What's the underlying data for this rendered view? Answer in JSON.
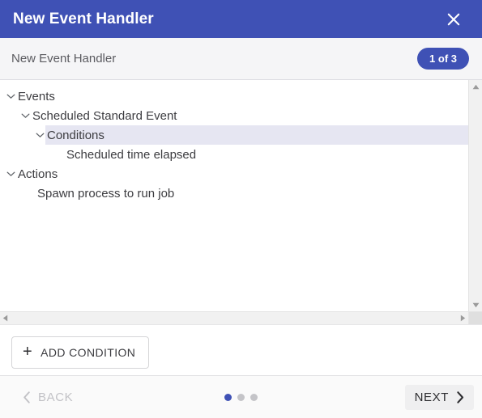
{
  "titlebar": {
    "title": "New Event Handler",
    "close_icon": "close-icon"
  },
  "subheader": {
    "title": "New Event Handler",
    "step_badge": "1 of 3"
  },
  "tree": {
    "rows": [
      {
        "label": "Events",
        "level": 0,
        "expanded": true,
        "has_chevron": true,
        "selected": false
      },
      {
        "label": "Scheduled Standard Event",
        "level": 1,
        "expanded": true,
        "has_chevron": true,
        "selected": false
      },
      {
        "label": "Conditions",
        "level": 2,
        "expanded": true,
        "has_chevron": true,
        "selected": true
      },
      {
        "label": "Scheduled time elapsed",
        "level": 3,
        "expanded": false,
        "has_chevron": false,
        "selected": false
      },
      {
        "label": "Actions",
        "level": 0,
        "expanded": true,
        "has_chevron": true,
        "selected": false
      },
      {
        "label": "Spawn process to run job",
        "level": 2,
        "expanded": false,
        "has_chevron": false,
        "selected": false
      }
    ]
  },
  "scrollbars": {
    "v_up_icon": "caret-up-icon",
    "v_down_icon": "caret-down-icon",
    "h_left_icon": "caret-left-icon",
    "h_right_icon": "caret-right-icon"
  },
  "actions": {
    "add_condition_label": "ADD CONDITION",
    "add_icon": "plus-icon"
  },
  "footer": {
    "back_label": "BACK",
    "next_label": "NEXT",
    "back_icon": "chevron-left-icon",
    "next_icon": "chevron-right-icon",
    "dots": [
      {
        "active": true
      },
      {
        "active": false
      },
      {
        "active": false
      }
    ]
  },
  "colors": {
    "accent": "#3f51b5",
    "selection": "#e6e6f2",
    "subheader_bg": "#f5f5f7",
    "footer_bg": "#fafafa",
    "text": "#3c3c40",
    "muted": "#c2c2c6"
  }
}
